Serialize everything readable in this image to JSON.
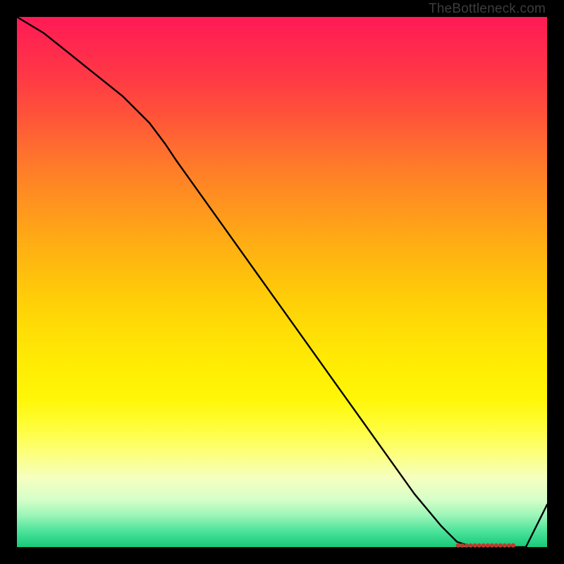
{
  "attribution": "TheBottleneck.com",
  "colors": {
    "frame": "#000000",
    "attribution_text": "#3d3d3d",
    "curve": "#000000",
    "dots": "#c0392b"
  },
  "chart_data": {
    "type": "line",
    "title": "",
    "xlabel": "",
    "ylabel": "",
    "xlim": [
      0,
      100
    ],
    "ylim": [
      0,
      100
    ],
    "x": [
      0,
      5,
      10,
      15,
      20,
      25,
      28,
      30,
      35,
      40,
      45,
      50,
      55,
      60,
      65,
      70,
      75,
      80,
      83,
      86,
      88,
      90,
      92,
      94,
      96,
      100
    ],
    "y": [
      100,
      97,
      93,
      89,
      85,
      80,
      76,
      73,
      66,
      59,
      52,
      45,
      38,
      31,
      24,
      17,
      10,
      4,
      1,
      0,
      0,
      0,
      0,
      0,
      0,
      8
    ],
    "notes": "Values estimated from pixel positions; y-axis assumed 0-100 scale (no visible tick labels). Dotted red markers lie along the flat minimum between roughly x=83 and x=94."
  },
  "dots": {
    "y": 0.3,
    "x": [
      83.2,
      84.0,
      84.8,
      85.6,
      86.4,
      87.2,
      88.0,
      88.8,
      89.6,
      90.4,
      91.2,
      92.0,
      92.8,
      93.6
    ]
  }
}
